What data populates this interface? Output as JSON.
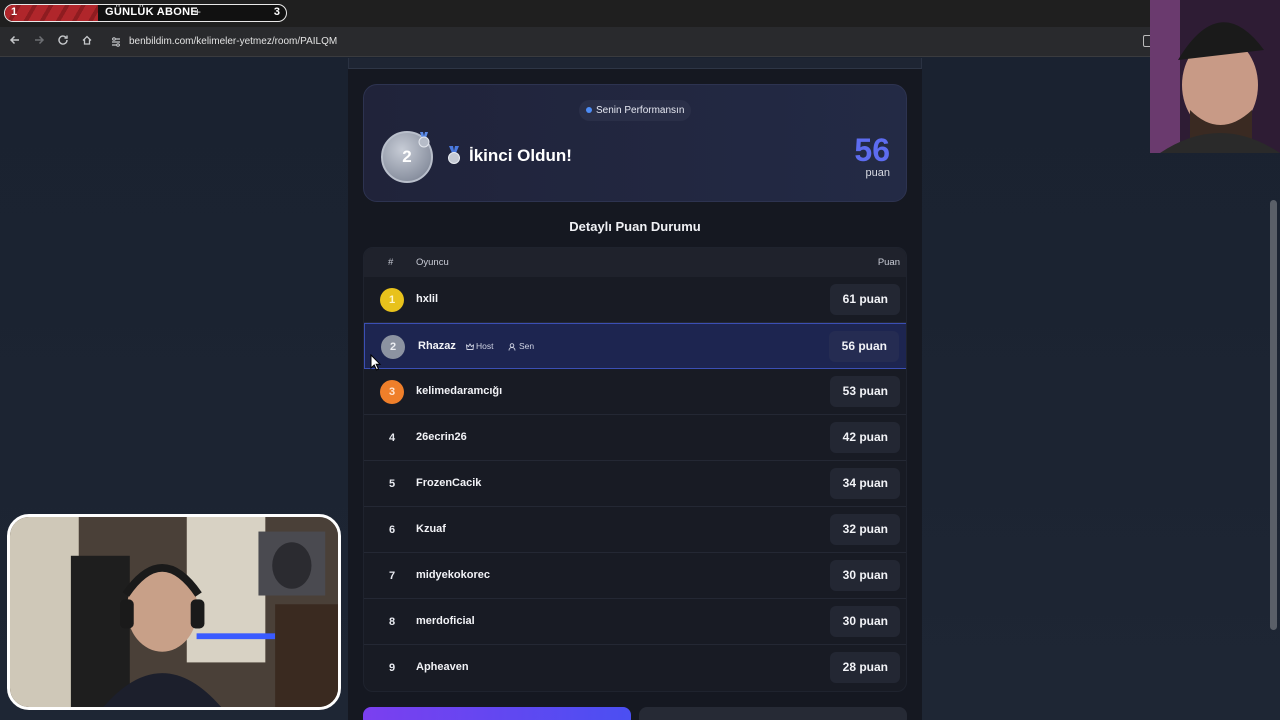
{
  "overlay": {
    "sub_left": "1",
    "sub_label": "GÜNLÜK ABONE",
    "sub_plus": "+",
    "sub_right": "3",
    "sub_progress": 0.33
  },
  "browser": {
    "url": "benbildim.com/kelimeler-yetmez/room/PAILQM",
    "icons": [
      "back-icon",
      "forward-icon",
      "reload-icon",
      "home-icon",
      "site-settings-icon",
      "extension-icon"
    ]
  },
  "performance": {
    "pill": "Senin Performansın",
    "medal_rank": "2",
    "medal_badge": "2",
    "result": "İkinci Oldun!",
    "score": "56",
    "unit": "puan"
  },
  "leaderboard": {
    "title": "Detaylı Puan Durumu",
    "headers": {
      "rank": "#",
      "player": "Oyuncu",
      "points": "Puan"
    },
    "host_tag": "Host",
    "you_tag": "Sen",
    "rows": [
      {
        "rank": "1",
        "name": "hxlil",
        "points": "61 puan"
      },
      {
        "rank": "2",
        "name": "Rhazaz",
        "points": "56 puan"
      },
      {
        "rank": "3",
        "name": "kelimedaramcığı",
        "points": "53 puan"
      },
      {
        "rank": "4",
        "name": "26ecrin26",
        "points": "42 puan"
      },
      {
        "rank": "5",
        "name": "FrozenCacik",
        "points": "34 puan"
      },
      {
        "rank": "6",
        "name": "Kzuaf",
        "points": "32 puan"
      },
      {
        "rank": "7",
        "name": "midyekokorec",
        "points": "30 puan"
      },
      {
        "rank": "8",
        "name": "merdoficial",
        "points": "30 puan"
      },
      {
        "rank": "9",
        "name": "Apheaven",
        "points": "28 puan"
      }
    ]
  },
  "colors": {
    "accent": "#5d6cf0",
    "gold": "#e8c21c",
    "silver": "#8c93a1",
    "bronze": "#ef7f2a",
    "highlight_row": "#1d2550"
  }
}
